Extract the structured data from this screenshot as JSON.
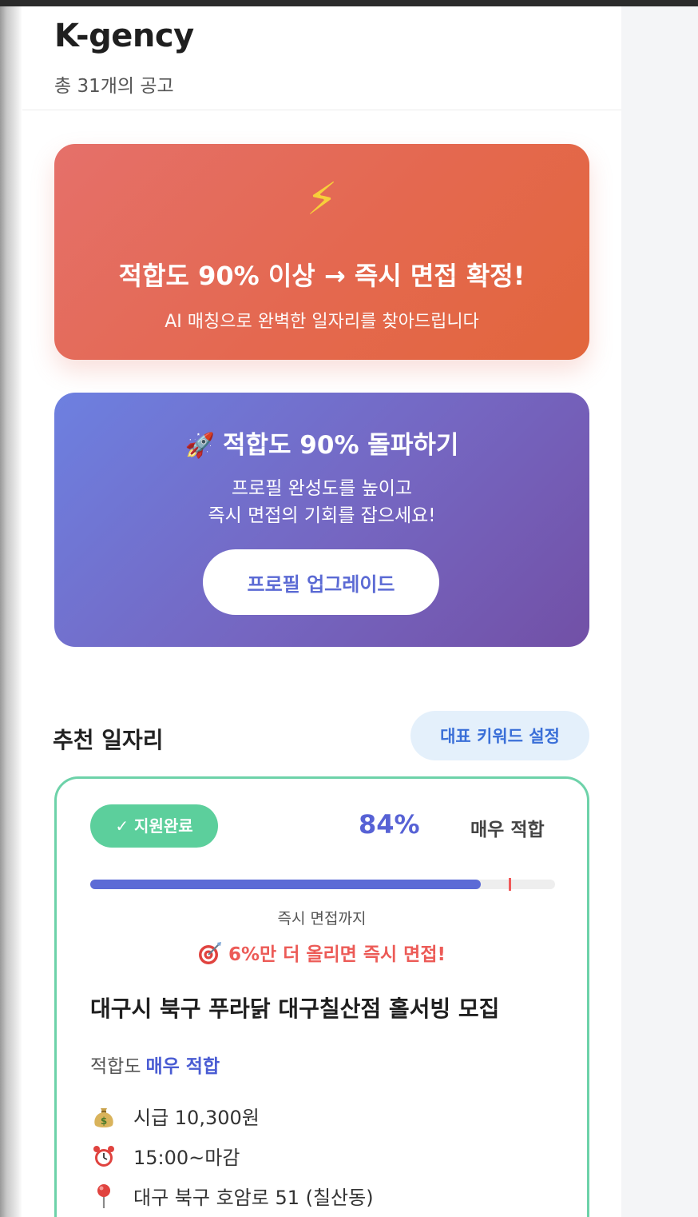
{
  "header": {
    "title": "K-gency",
    "job_count": "총 31개의 공고"
  },
  "promo_banner": {
    "icon": "lightning-icon",
    "icon_glyph": "⚡",
    "title": "적합도 90% 이상 → 즉시 면접 확정!",
    "subtitle": "AI 매칭으로 완벽한 일자리를 찾아드립니다"
  },
  "upgrade_banner": {
    "icon": "rocket-icon",
    "icon_glyph": "🚀",
    "title": "적합도 90% 돌파하기",
    "desc_line1": "프로필 완성도를 높이고",
    "desc_line2": "즉시 면접의 기회를 잡으세요!",
    "button_label": "프로필 업그레이드"
  },
  "recommend": {
    "section_title": "추천 일자리",
    "keyword_button": "대표 키워드 설정"
  },
  "job_card": {
    "status_badge": "✓ 지원완료",
    "match_percent_text": "84%",
    "match_label": "매우 적합",
    "progress": 0.84,
    "threshold": 0.9,
    "until_label": "즉시 면접까지",
    "boost_message": "6%만 더 올리면 즉시 면접!",
    "title": "대구시 북구 푸라닭 대구칠산점 홀서빙 모집",
    "fit_label": "적합도",
    "fit_value": "매우 적합",
    "wage": "시급 10,300원",
    "hours": "15:00~마감",
    "address": "대구 북구 호암로 51 (칠산동)"
  },
  "colors": {
    "accent_blue": "#5c6bd6",
    "card_border": "#6dd2a9",
    "badge_green": "#5ccf9c",
    "alert_red": "#ec5b57"
  }
}
